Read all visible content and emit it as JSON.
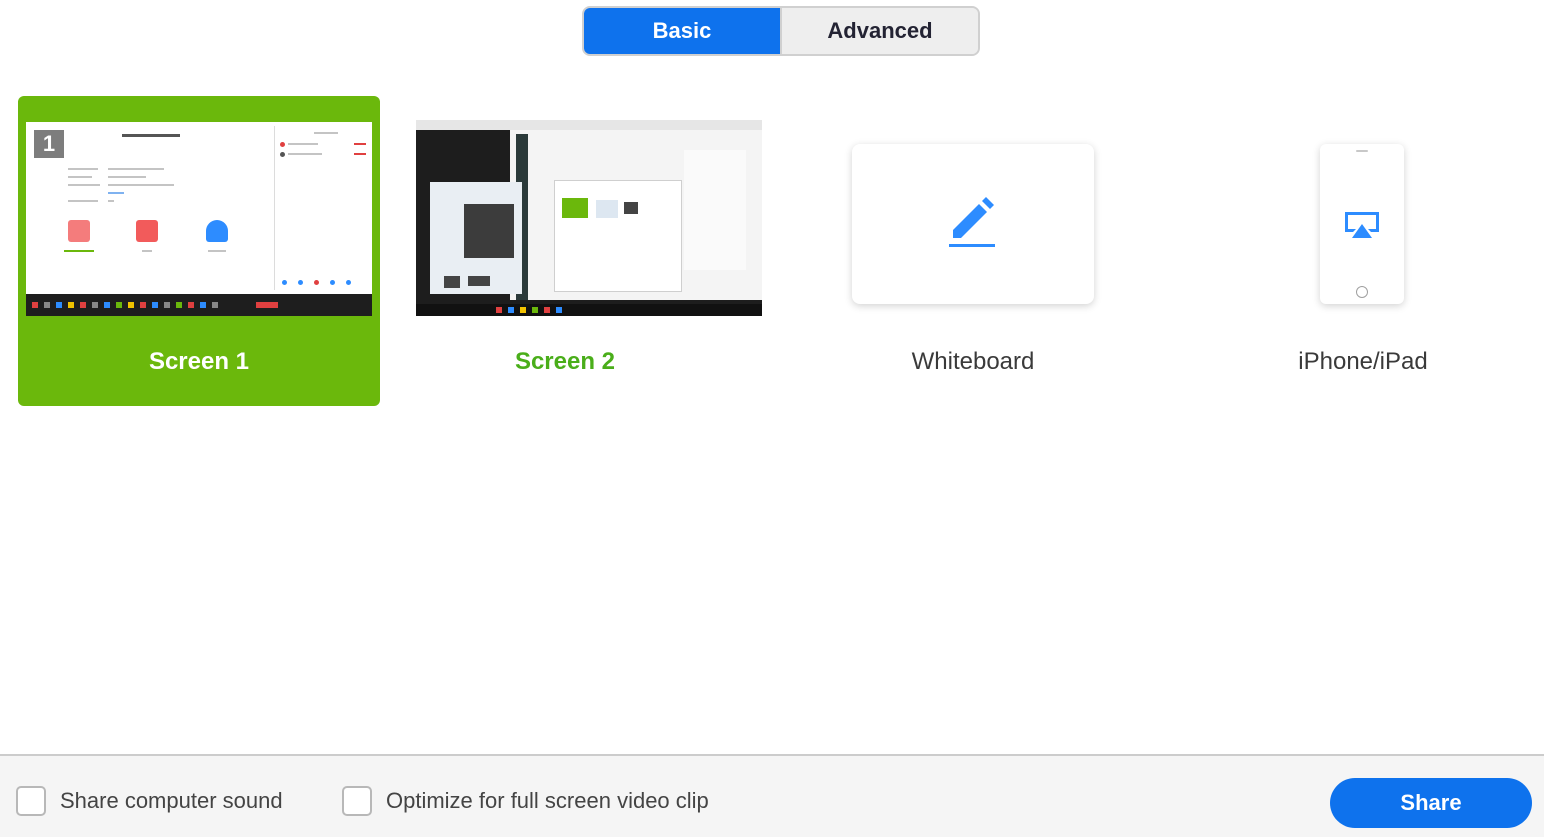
{
  "tabs": {
    "basic": "Basic",
    "advanced": "Advanced",
    "active": "Basic"
  },
  "share_options": [
    {
      "label": "Screen 1",
      "selected": true,
      "icon": "screen-thumbnail",
      "badge": "1"
    },
    {
      "label": "Screen 2",
      "selected": false,
      "icon": "screen-thumbnail"
    },
    {
      "label": "Whiteboard",
      "selected": false,
      "icon": "pencil-icon"
    },
    {
      "label": "iPhone/iPad",
      "selected": false,
      "icon": "airplay-icon"
    }
  ],
  "footer": {
    "share_sound_label": "Share computer sound",
    "share_sound_checked": false,
    "optimize_label": "Optimize for full screen video clip",
    "optimize_checked": false,
    "share_button": "Share"
  },
  "colors": {
    "accent_blue": "#0e72ed",
    "selected_green": "#6bb80c",
    "label_green": "#4aae1a"
  }
}
